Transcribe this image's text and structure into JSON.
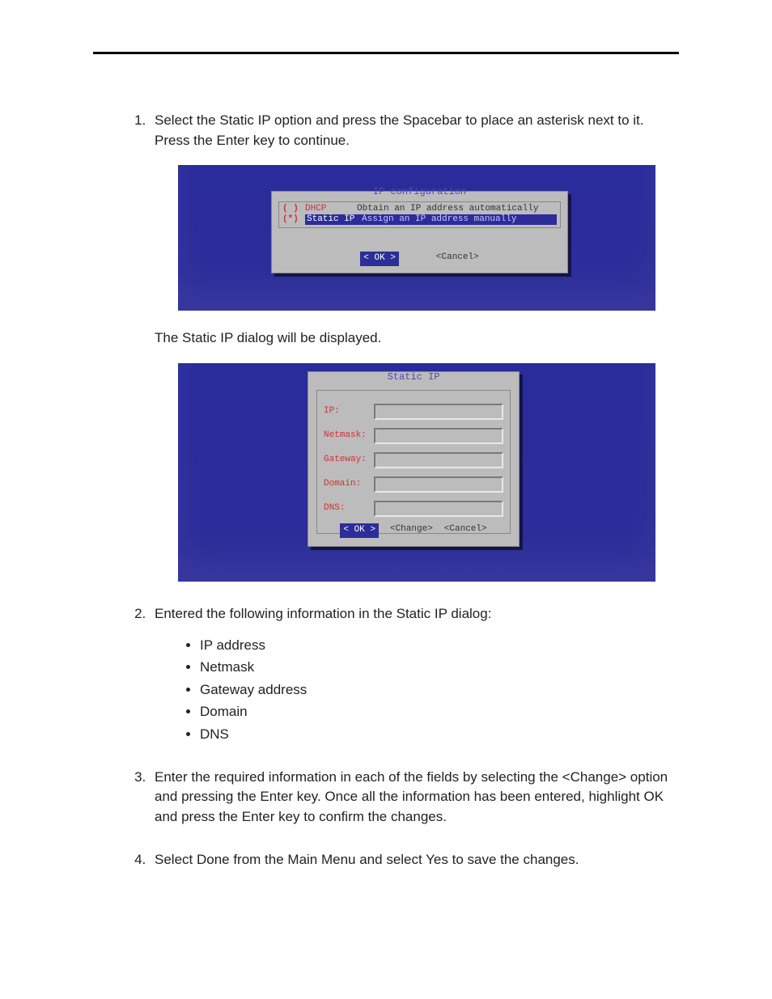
{
  "steps": {
    "s1": "Select the Static IP option and press the Spacebar to place an asterisk next to it.  Press the Enter key to continue.",
    "s1_after": "The Static IP dialog will be displayed.",
    "s2": "Entered the following information in the Static IP dialog:",
    "s2_bullets": {
      "b1": "IP address",
      "b2": "Netmask",
      "b3": "Gateway address",
      "b4": "Domain",
      "b5": "DNS"
    },
    "s3": "Enter the required information in each of the fields by selecting the <Change> option and pressing the Enter key.  Once all the information has been entered, highlight OK and press the Enter key to confirm the changes.",
    "s4": "Select Done from the Main Menu and select Yes to save the changes."
  },
  "screenshot1": {
    "dialog_title": "IP configuration",
    "row1_mark": "( )",
    "row1_label": "DHCP",
    "row1_desc": "Obtain an IP address automatically",
    "row2_mark": "(*)",
    "row2_label": "Static IP",
    "row2_desc": "Assign an IP address manually",
    "ok": "<  OK  >",
    "cancel": "<Cancel>"
  },
  "screenshot2": {
    "dialog_title": "Static IP",
    "labels": {
      "ip": "IP:",
      "netmask": "Netmask:",
      "gateway": "Gateway:",
      "domain": "Domain:",
      "dns": "DNS:"
    },
    "ok": "<  OK  >",
    "change": "<Change>",
    "cancel": "<Cancel>"
  }
}
